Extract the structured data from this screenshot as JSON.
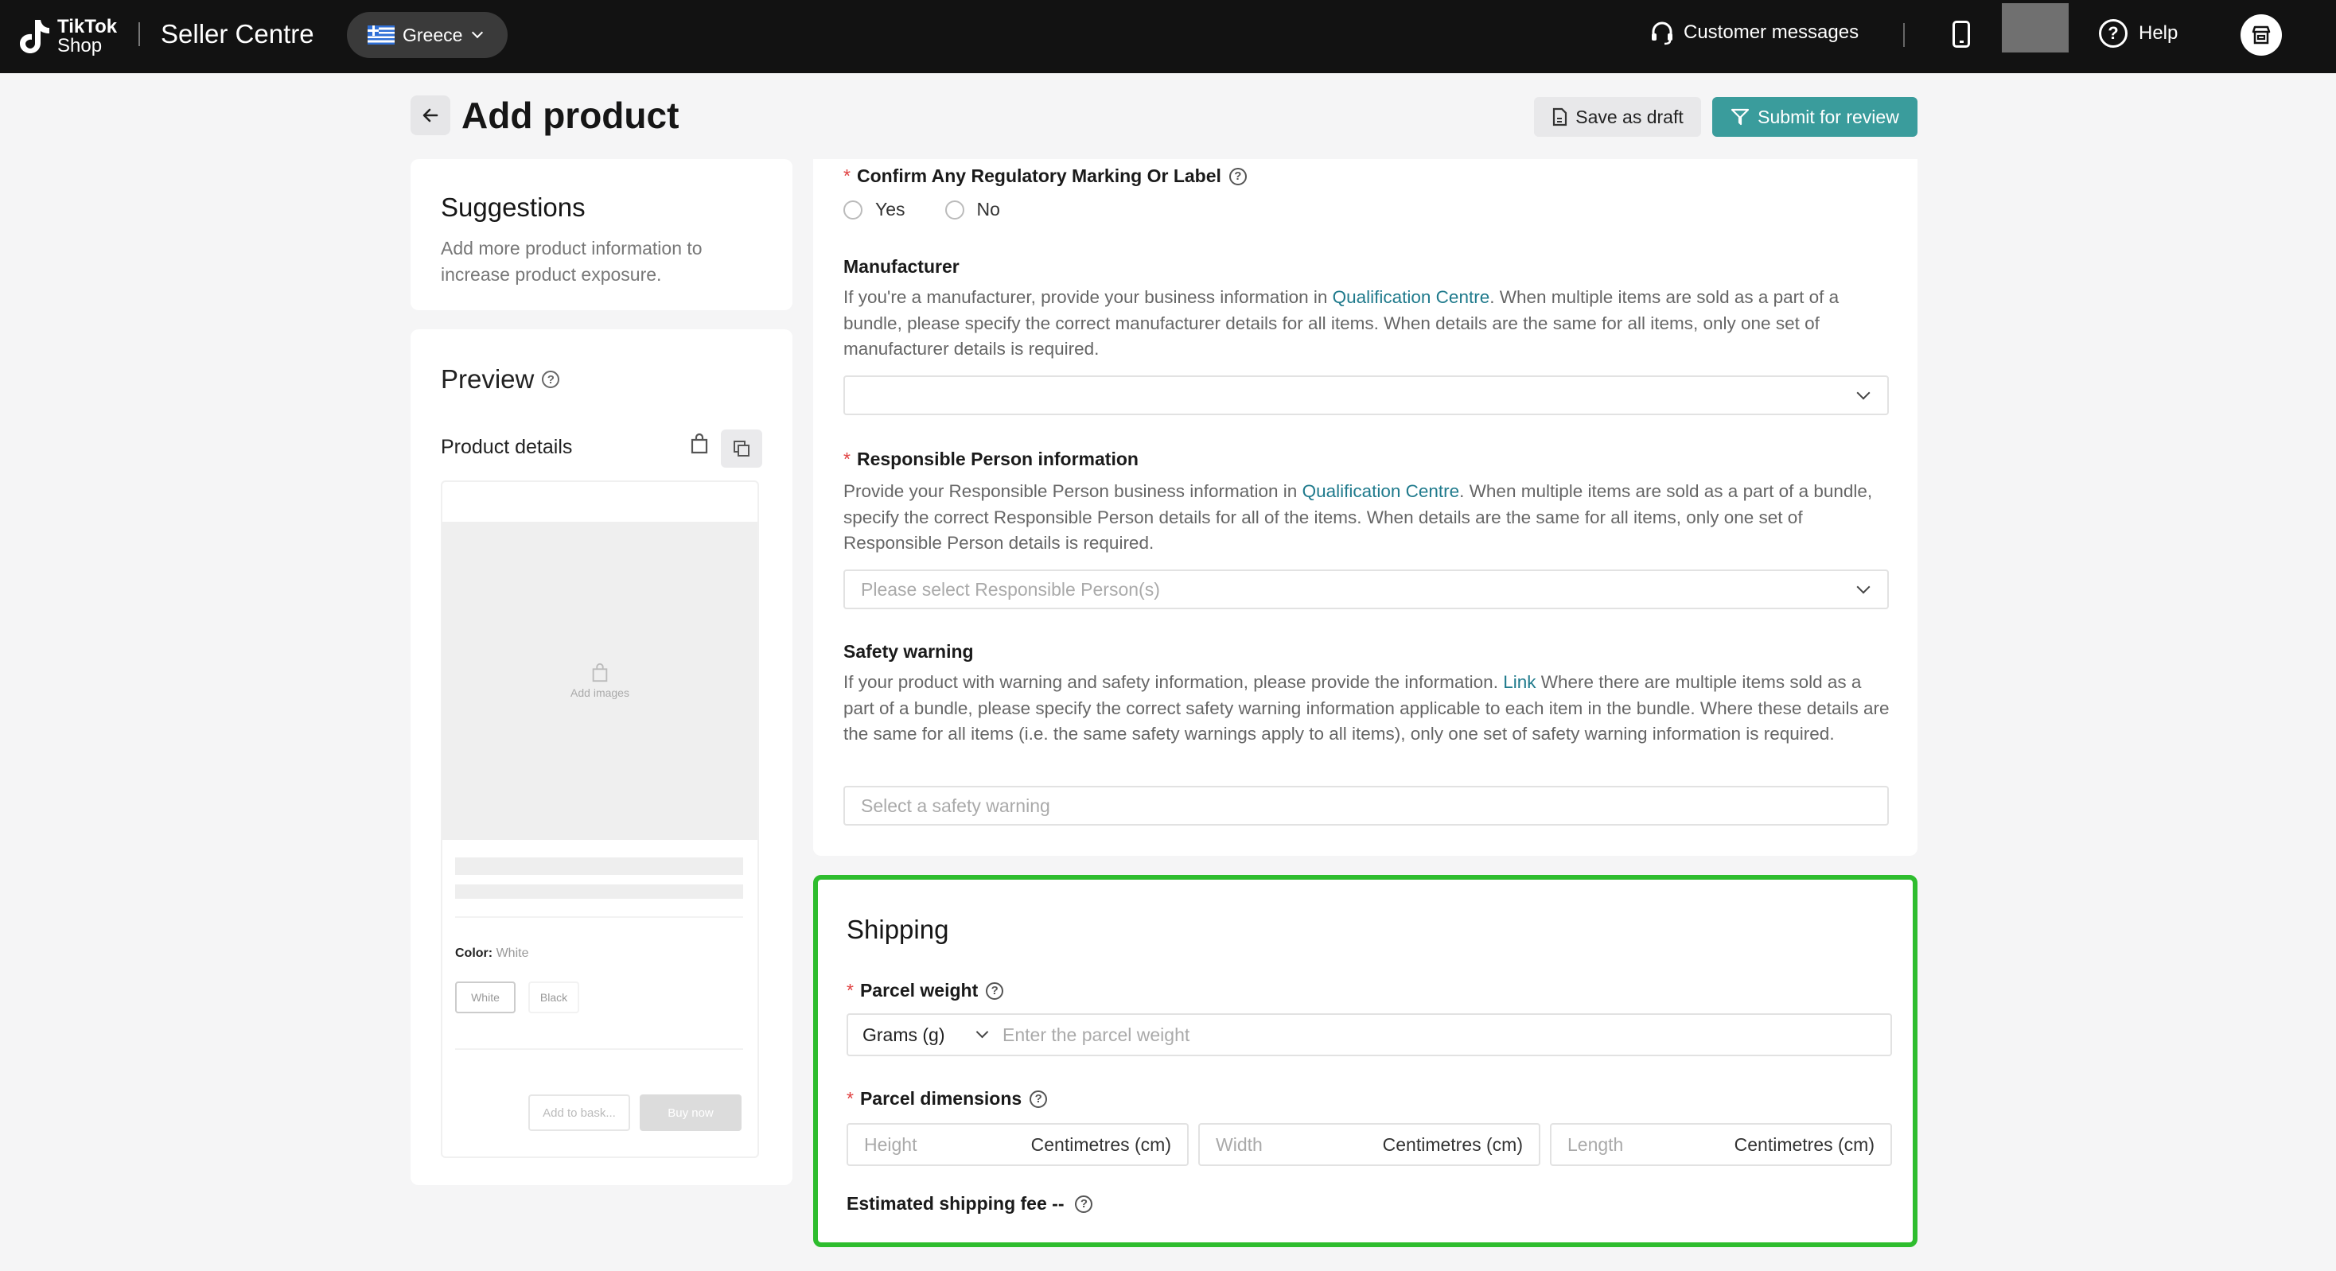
{
  "topbar": {
    "logo_line1": "TikTok",
    "logo_line2": "Shop",
    "brand": "Seller Centre",
    "region": "Greece",
    "customer_messages": "Customer messages",
    "help": "Help"
  },
  "header": {
    "title": "Add product",
    "save_draft": "Save as draft",
    "submit": "Submit for review"
  },
  "suggestions": {
    "title": "Suggestions",
    "text": "Add more product information to increase product exposure."
  },
  "preview": {
    "title": "Preview",
    "product_details": "Product details",
    "add_images": "Add images",
    "color_label": "Color:",
    "color_value": "White",
    "chips": [
      "White",
      "Black"
    ],
    "add_to_basket": "Add to bask...",
    "buy_now": "Buy now"
  },
  "form": {
    "regulatory": {
      "label": "Confirm Any Regulatory Marking Or Label",
      "options": [
        "Yes",
        "No"
      ]
    },
    "manufacturer": {
      "label": "Manufacturer",
      "desc_pre": "If you're a manufacturer, provide your business information in ",
      "desc_link": "Qualification Centre",
      "desc_post": ". When multiple items are sold as a part of a bundle, please specify the correct manufacturer details for all items. When details are the same for all items, only one set of manufacturer details is required.",
      "placeholder": ""
    },
    "responsible": {
      "label": "Responsible Person information",
      "desc_pre": "Provide your Responsible Person business information in ",
      "desc_link": "Qualification Centre",
      "desc_post": ". When multiple items are sold as a part of a bundle, specify the correct Responsible Person details for all of the items. When details are the same for all items, only one set of Responsible Person details is required.",
      "placeholder": "Please select Responsible Person(s)"
    },
    "safety": {
      "label": "Safety warning",
      "desc_pre": "If your product with warning and safety information, please provide the information. ",
      "desc_link": "Link",
      "desc_post": " Where there are multiple items sold as a part of a bundle, please specify the correct safety warning information applicable to each item in the bundle. Where these details are the same for all items (i.e. the same safety warnings apply to all items), only one set of safety warning information is required.",
      "placeholder": "Select a safety warning"
    }
  },
  "shipping": {
    "title": "Shipping",
    "weight_label": "Parcel weight",
    "weight_unit": "Grams (g)",
    "weight_placeholder": "Enter the parcel weight",
    "dims_label": "Parcel dimensions",
    "dims": [
      {
        "placeholder": "Height",
        "unit": "Centimetres (cm)"
      },
      {
        "placeholder": "Width",
        "unit": "Centimetres (cm)"
      },
      {
        "placeholder": "Length",
        "unit": "Centimetres (cm)"
      }
    ],
    "estimated_fee": "Estimated shipping fee --"
  },
  "colors": {
    "accent": "#3a9c9c",
    "link": "#1f7a8c",
    "highlight": "#2ebd2e",
    "required": "#e04040"
  }
}
